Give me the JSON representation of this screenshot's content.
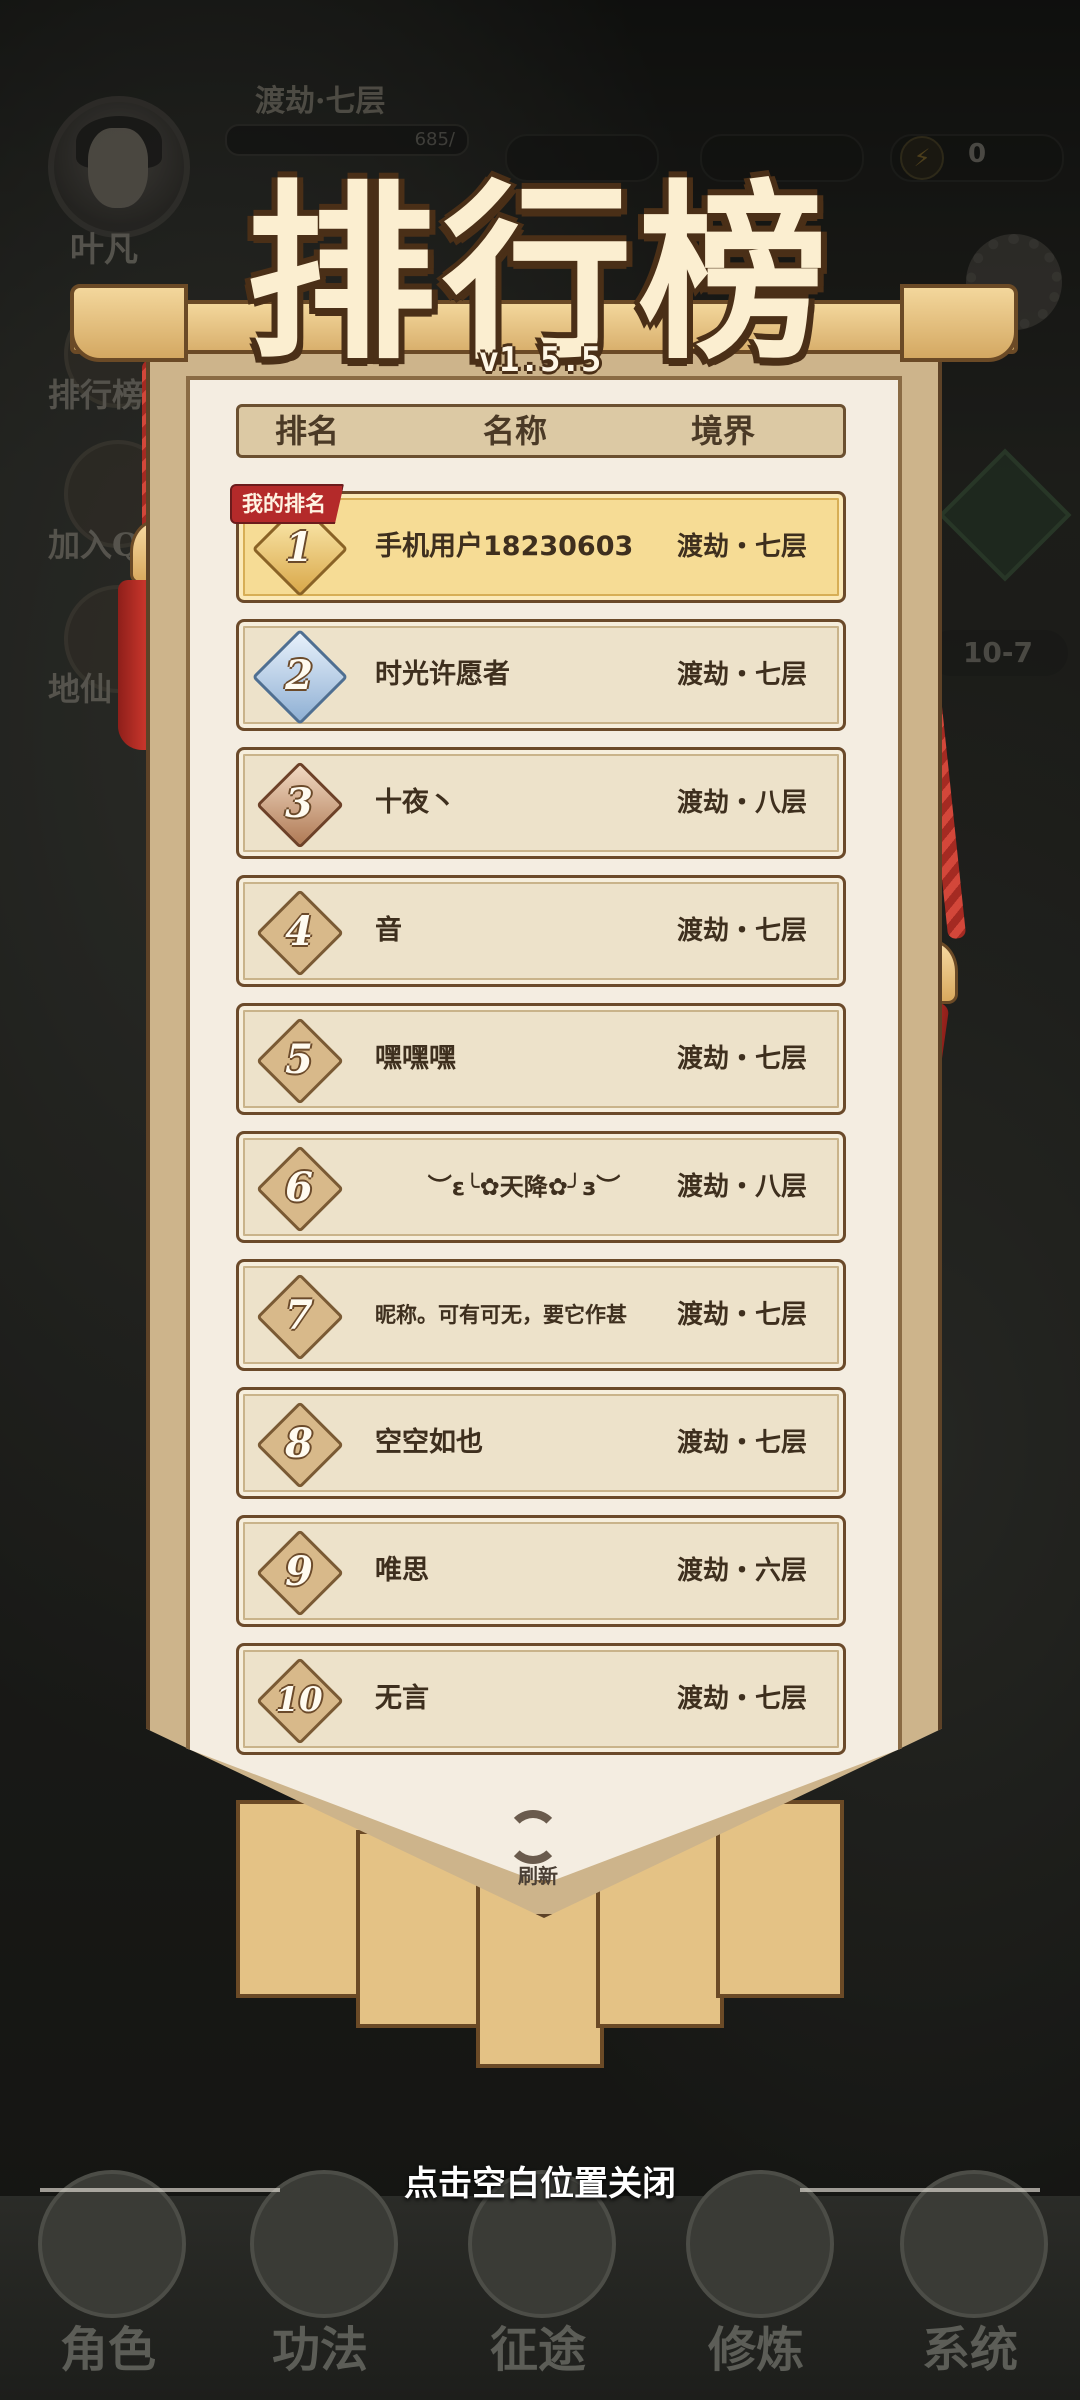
{
  "hud": {
    "player_name": "叶凡",
    "realm": "渡劫·七层",
    "hp_text": "685/",
    "energy": "0",
    "energy_icon": "lightning-icon",
    "stage": "10-7",
    "side_buttons": [
      "排行榜",
      "加入Q",
      "地仙"
    ]
  },
  "title": "排行榜",
  "version": "v1.5.5",
  "headers": {
    "rank": "排名",
    "name": "名称",
    "realm": "境界"
  },
  "my_rank_tag": "我的排名",
  "rows": [
    {
      "rank": "1",
      "name": "手机用户18230603",
      "realm": "渡劫・七层"
    },
    {
      "rank": "2",
      "name": "时光许愿者",
      "realm": "渡劫・七层"
    },
    {
      "rank": "3",
      "name": "十夜丶",
      "realm": "渡劫・八层"
    },
    {
      "rank": "4",
      "name": "音",
      "realm": "渡劫・七层"
    },
    {
      "rank": "5",
      "name": "嘿嘿嘿",
      "realm": "渡劫・七层"
    },
    {
      "rank": "6",
      "name": "︶ε╰✿天降✿╯з︶",
      "realm": "渡劫・八层"
    },
    {
      "rank": "7",
      "name": "昵称。可有可无，要它作甚",
      "realm": "渡劫・七层"
    },
    {
      "rank": "8",
      "name": "空空如也",
      "realm": "渡劫・七层"
    },
    {
      "rank": "9",
      "name": "唯思",
      "realm": "渡劫・六层"
    },
    {
      "rank": "10",
      "name": "无言",
      "realm": "渡劫・七层"
    }
  ],
  "refresh_label": "刷新",
  "close_hint": "点击空白位置关闭",
  "nav": [
    "角色",
    "功法",
    "征途",
    "修炼",
    "系统"
  ],
  "colors": {
    "row_highlight": "#f6dc95",
    "tag_red": "#b42a2a",
    "banner": "#f4ede1"
  }
}
